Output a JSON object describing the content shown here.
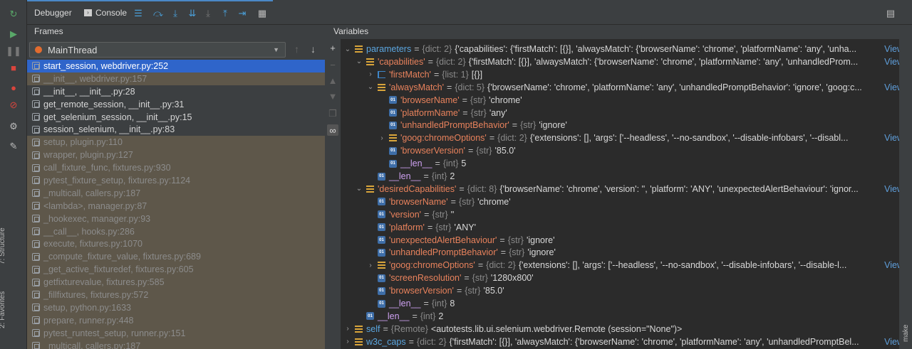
{
  "toolbar": {
    "tabs": [
      {
        "label": "Debugger",
        "active": true
      },
      {
        "label": "Console",
        "active": false
      }
    ],
    "icons": [
      "restore-layout-icon",
      "step-over-icon",
      "step-into-icon",
      "force-step-into-icon",
      "step-out-icon",
      "run-to-cursor-icon",
      "evaluate-expression-icon"
    ]
  },
  "left_bar": {
    "icons": [
      "rerun-icon",
      "resume-icon",
      "pause-icon",
      "stop-icon",
      "view-breakpoints-icon",
      "mute-breakpoints-icon",
      "settings-icon",
      "pin-icon"
    ],
    "structure_label": "7: Structure",
    "favorites_label": "2: Favorites"
  },
  "right_label": "make",
  "frames": {
    "header": "Frames",
    "thread": "MainThread",
    "items": [
      {
        "label": "start_session, webdriver.py:252",
        "state": "selected"
      },
      {
        "label": "__init__, webdriver.py:157",
        "state": "library"
      },
      {
        "label": "__init__, __init__.py:28",
        "state": "normal"
      },
      {
        "label": "get_remote_session, __init__.py:31",
        "state": "normal"
      },
      {
        "label": "get_selenium_session, __init__.py:15",
        "state": "normal"
      },
      {
        "label": "session_selenium, __init__.py:83",
        "state": "normal"
      },
      {
        "label": "setup, plugin.py:110",
        "state": "library"
      },
      {
        "label": "wrapper, plugin.py:127",
        "state": "library"
      },
      {
        "label": "call_fixture_func, fixtures.py:930",
        "state": "library"
      },
      {
        "label": "pytest_fixture_setup, fixtures.py:1124",
        "state": "library"
      },
      {
        "label": "_multicall, callers.py:187",
        "state": "library"
      },
      {
        "label": "<lambda>, manager.py:87",
        "state": "library"
      },
      {
        "label": "_hookexec, manager.py:93",
        "state": "library"
      },
      {
        "label": "__call__, hooks.py:286",
        "state": "library"
      },
      {
        "label": "execute, fixtures.py:1070",
        "state": "library"
      },
      {
        "label": "_compute_fixture_value, fixtures.py:689",
        "state": "library"
      },
      {
        "label": "_get_active_fixturedef, fixtures.py:605",
        "state": "library"
      },
      {
        "label": "getfixturevalue, fixtures.py:585",
        "state": "library"
      },
      {
        "label": "_fillfixtures, fixtures.py:572",
        "state": "library"
      },
      {
        "label": "setup, python.py:1633",
        "state": "library"
      },
      {
        "label": "prepare, runner.py:448",
        "state": "library"
      },
      {
        "label": "pytest_runtest_setup, runner.py:151",
        "state": "library"
      },
      {
        "label": "_multicall, callers.py:187",
        "state": "library"
      }
    ]
  },
  "variables": {
    "header": "Variables",
    "view_label": "View",
    "rows": [
      {
        "depth": 0,
        "expander": "open",
        "icon": "dict",
        "key": "parameters",
        "key_style": "blue",
        "type": "{dict: 2}",
        "value": "{'capabilities': {'firstMatch': [{}], 'alwaysMatch': {'browserName': 'chrome', 'platformName': 'any', 'unha...",
        "view": true
      },
      {
        "depth": 1,
        "expander": "open",
        "icon": "dict",
        "key": "'capabilities'",
        "key_style": "str",
        "type": "{dict: 2}",
        "value": "{'firstMatch': [{}], 'alwaysMatch': {'browserName': 'chrome', 'platformName': 'any', 'unhandledProm...",
        "view": true
      },
      {
        "depth": 2,
        "expander": "closed",
        "icon": "list",
        "key": "'firstMatch'",
        "key_style": "str",
        "type": "{list: 1}",
        "value": "[{}]",
        "view": false
      },
      {
        "depth": 2,
        "expander": "open",
        "icon": "dict",
        "key": "'alwaysMatch'",
        "key_style": "str",
        "type": "{dict: 5}",
        "value": "{'browserName': 'chrome', 'platformName': 'any', 'unhandledPromptBehavior': 'ignore', 'goog:c...",
        "view": true
      },
      {
        "depth": 3,
        "expander": "none",
        "icon": "prim",
        "key": "'browserName'",
        "key_style": "str",
        "type": "{str}",
        "value": "'chrome'",
        "view": false
      },
      {
        "depth": 3,
        "expander": "none",
        "icon": "prim",
        "key": "'platformName'",
        "key_style": "str",
        "type": "{str}",
        "value": "'any'",
        "view": false
      },
      {
        "depth": 3,
        "expander": "none",
        "icon": "prim",
        "key": "'unhandledPromptBehavior'",
        "key_style": "str",
        "type": "{str}",
        "value": "'ignore'",
        "view": false
      },
      {
        "depth": 3,
        "expander": "closed",
        "icon": "dict",
        "key": "'goog:chromeOptions'",
        "key_style": "str",
        "type": "{dict: 2}",
        "value": "{'extensions': [], 'args': ['--headless', '--no-sandbox', '--disable-infobars', '--disabl...",
        "view": true
      },
      {
        "depth": 3,
        "expander": "none",
        "icon": "prim",
        "key": "'browserVersion'",
        "key_style": "str",
        "type": "{str}",
        "value": "'85.0'",
        "view": false
      },
      {
        "depth": 3,
        "expander": "none",
        "icon": "prim",
        "key": "__len__",
        "key_style": "plain",
        "type": "{int}",
        "value": "5",
        "view": false
      },
      {
        "depth": 2,
        "expander": "none",
        "icon": "prim",
        "key": "__len__",
        "key_style": "plain",
        "type": "{int}",
        "value": "2",
        "view": false
      },
      {
        "depth": 1,
        "expander": "open",
        "icon": "dict",
        "key": "'desiredCapabilities'",
        "key_style": "str",
        "type": "{dict: 8}",
        "value": "{'browserName': 'chrome', 'version': '', 'platform': 'ANY', 'unexpectedAlertBehaviour': 'ignor...",
        "view": true
      },
      {
        "depth": 2,
        "expander": "none",
        "icon": "prim",
        "key": "'browserName'",
        "key_style": "str",
        "type": "{str}",
        "value": "'chrome'",
        "view": false
      },
      {
        "depth": 2,
        "expander": "none",
        "icon": "prim",
        "key": "'version'",
        "key_style": "str",
        "type": "{str}",
        "value": "''",
        "view": false
      },
      {
        "depth": 2,
        "expander": "none",
        "icon": "prim",
        "key": "'platform'",
        "key_style": "str",
        "type": "{str}",
        "value": "'ANY'",
        "view": false
      },
      {
        "depth": 2,
        "expander": "none",
        "icon": "prim",
        "key": "'unexpectedAlertBehaviour'",
        "key_style": "str",
        "type": "{str}",
        "value": "'ignore'",
        "view": false
      },
      {
        "depth": 2,
        "expander": "none",
        "icon": "prim",
        "key": "'unhandledPromptBehavior'",
        "key_style": "str",
        "type": "{str}",
        "value": "'ignore'",
        "view": false
      },
      {
        "depth": 2,
        "expander": "closed",
        "icon": "dict",
        "key": "'goog:chromeOptions'",
        "key_style": "str",
        "type": "{dict: 2}",
        "value": "{'extensions': [], 'args': ['--headless', '--no-sandbox', '--disable-infobars', '--disable-l...",
        "view": true
      },
      {
        "depth": 2,
        "expander": "none",
        "icon": "prim",
        "key": "'screenResolution'",
        "key_style": "str",
        "type": "{str}",
        "value": "'1280x800'",
        "view": false
      },
      {
        "depth": 2,
        "expander": "none",
        "icon": "prim",
        "key": "'browserVersion'",
        "key_style": "str",
        "type": "{str}",
        "value": "'85.0'",
        "view": false
      },
      {
        "depth": 2,
        "expander": "none",
        "icon": "prim",
        "key": "__len__",
        "key_style": "plain",
        "type": "{int}",
        "value": "8",
        "view": false
      },
      {
        "depth": 1,
        "expander": "none",
        "icon": "prim",
        "key": "__len__",
        "key_style": "plain",
        "type": "{int}",
        "value": "2",
        "view": false
      },
      {
        "depth": 0,
        "expander": "closed",
        "icon": "dict",
        "key": "self",
        "key_style": "blue",
        "type": "{Remote}",
        "value": "<autotests.lib.ui.selenium.webdriver.Remote (session=\"None\")>",
        "view": false
      },
      {
        "depth": 0,
        "expander": "closed",
        "icon": "dict",
        "key": "w3c_caps",
        "key_style": "blue",
        "type": "{dict: 2}",
        "value": "{'firstMatch': [{}], 'alwaysMatch': {'browserName': 'chrome', 'platformName': 'any', 'unhandledPromptBel...",
        "view": true
      }
    ]
  },
  "colors": {
    "selected_frame": "#2f65ca",
    "library_frame": "#5e574a",
    "string_key": "#e8825c",
    "link": "#5f9fdc"
  }
}
